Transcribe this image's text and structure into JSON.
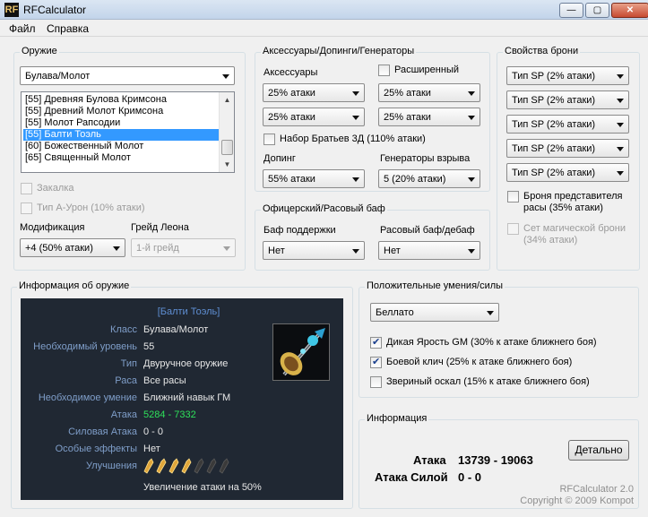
{
  "window": {
    "title": "RFCalculator",
    "icon_text": "RF",
    "buttons": {
      "minimize": "—",
      "maximize": "▢",
      "close": "✕"
    }
  },
  "menu": {
    "items": [
      "Файл",
      "Справка"
    ]
  },
  "weapon": {
    "title": "Оружие",
    "type_select": "Булава/Молот",
    "list_items": [
      "[55] Древняя Булова Кримсона",
      "[55] Древний Молот Кримсона",
      "[55] Молот Рапсодии",
      "[55] Балти Тоэль",
      "[60] Божественный Молот",
      "[65] Священный Молот"
    ],
    "selected_index": 3,
    "check_hardening": "Закалка",
    "check_type_a": "Тип А-Урон (10% атаки)",
    "mod_label": "Модификация",
    "mod_value": "+4 (50% атаки)",
    "grade_label": "Грейд Леона",
    "grade_value": "1-й грейд"
  },
  "accessories": {
    "title": "Аксессуары/Допинги/Генераторы",
    "acc_label": "Аксессуары",
    "extended_label": "Расширенный",
    "selects": [
      "25% атаки",
      "25% атаки",
      "25% атаки",
      "25% атаки"
    ],
    "brothers_label": "Набор Братьев 3Д (110% атаки)",
    "doping_label": "Допинг",
    "doping_value": "55% атаки",
    "generators_label": "Генераторы взрыва",
    "generators_value": "5 (20% атаки)"
  },
  "officer": {
    "title": "Офицерский/Расовый баф",
    "support_label": "Баф поддержки",
    "support_value": "Нет",
    "race_label": "Расовый баф/дебаф",
    "race_value": "Нет"
  },
  "armor": {
    "title": "Свойства брони",
    "selects": [
      "Тип SP (2% атаки)",
      "Тип SP (2% атаки)",
      "Тип SP (2% атаки)",
      "Тип SP (2% атаки)",
      "Тип SP (2% атаки)"
    ],
    "race_armor_line1": "Броня представителя",
    "race_armor_line2": "расы (35% атаки)",
    "magic_set_line1": "Сет магической брони",
    "magic_set_line2": "(34% атаки)"
  },
  "weapon_info": {
    "title": "Информация об оружие",
    "name": "[Балти Тоэль]",
    "rows": [
      {
        "k": "Класс",
        "v": "Булава/Молот"
      },
      {
        "k": "Необходимый уровень",
        "v": "55"
      },
      {
        "k": "Тип",
        "v": "Двуручное оружие"
      },
      {
        "k": "Раса",
        "v": "Все расы"
      },
      {
        "k": "Необходимое умение",
        "v": "Ближний навык ГМ"
      },
      {
        "k": "Атака",
        "v": "5284 - 7332"
      },
      {
        "k": "Силовая Атака",
        "v": "0 - 0"
      },
      {
        "k": "Особые эффекты",
        "v": "Нет"
      },
      {
        "k": "Улучшения",
        "v": ""
      }
    ],
    "upgrade_filled": 4,
    "upgrade_total": 7,
    "upgrade_text": "Увеличение атаки на 50%"
  },
  "skills": {
    "title": "Положительные умения/силы",
    "select_value": "Беллато",
    "items": [
      {
        "label": "Дикая Ярость GM (30% к атаке ближнего боя)",
        "checked": true
      },
      {
        "label": "Боевой клич (25% к атаке ближнего боя)",
        "checked": true
      },
      {
        "label": "Звериный оскал (15% к атаке ближнего боя)",
        "checked": false
      }
    ]
  },
  "info": {
    "title": "Информация",
    "attack_label": "Атака",
    "attack_value": "13739 - 19063",
    "force_label": "Атака Силой",
    "force_value": "0 - 0",
    "detail_button": "Детально",
    "footer_line1": "RFCalculator 2.0",
    "footer_line2": "Copyright © 2009 Kompot"
  }
}
